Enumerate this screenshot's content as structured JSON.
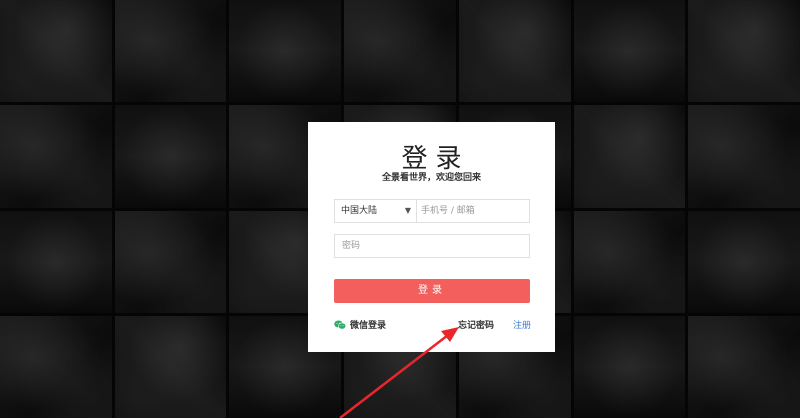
{
  "login": {
    "title": "登录",
    "subtitle": "全景看世界，欢迎您回来",
    "region_select": "中国大陆",
    "phone_placeholder": "手机号 / 邮箱",
    "password_placeholder": "密码",
    "login_button": "登录",
    "wechat_login": "微信登录",
    "forgot_password": "忘记密码",
    "register": "注册"
  },
  "colors": {
    "login_button": "#f25f5c",
    "register_link": "#3a7bd5",
    "annotation_arrow": "#e8262c",
    "wechat_icon": "#2aae67"
  }
}
